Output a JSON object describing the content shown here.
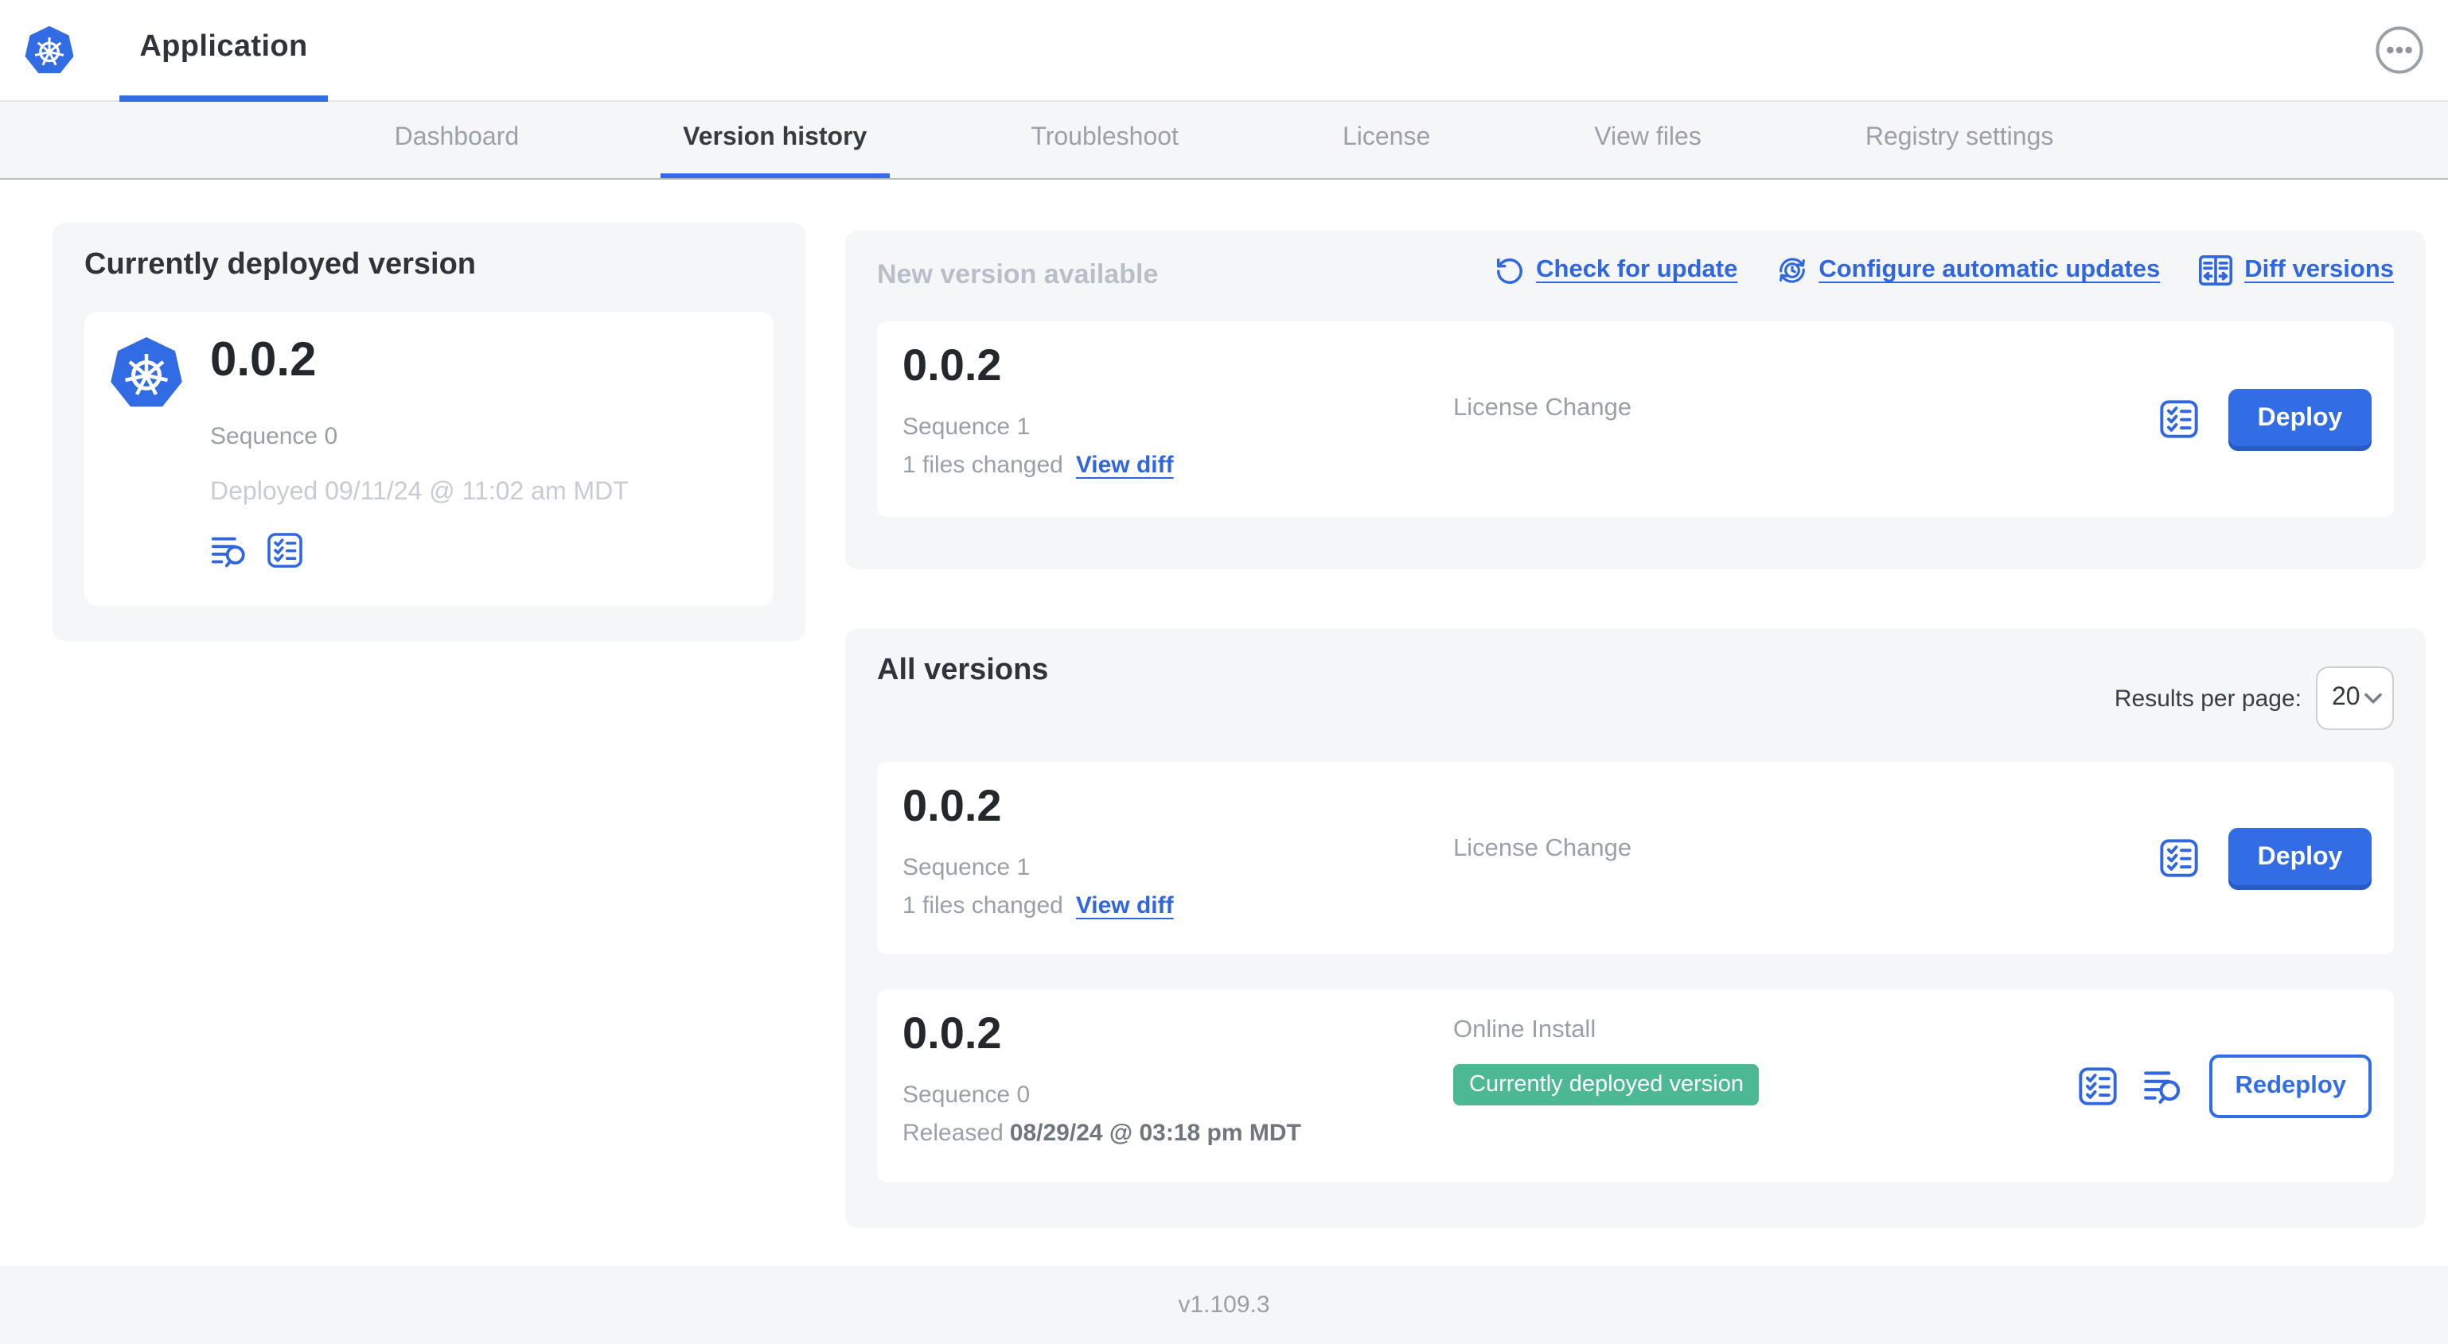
{
  "colors": {
    "accent": "#3066e0",
    "logo_blue": "#326ce5",
    "badge_green": "#4cb894",
    "button_blue": "#326de6"
  },
  "header": {
    "app_title": "Application",
    "menu_icon": "ellipsis-circle-icon",
    "logo_icon": "kubernetes-logo"
  },
  "nav": {
    "active_tab": "Version history",
    "tabs": [
      {
        "label": "Dashboard"
      },
      {
        "label": "Version history"
      },
      {
        "label": "Troubleshoot"
      },
      {
        "label": "License"
      },
      {
        "label": "View files"
      },
      {
        "label": "Registry settings"
      }
    ]
  },
  "current_version": {
    "title": "Currently deployed version",
    "version": "0.0.2",
    "sequence": "Sequence 0",
    "deployed": "Deployed 09/11/24 @ 11:02 am MDT",
    "icons": [
      "view-release-notes-icon",
      "preflight-checks-icon"
    ]
  },
  "new_version": {
    "title": "New version available",
    "actions": {
      "check": "Check for update",
      "configure": "Configure automatic updates",
      "diff": "Diff versions"
    },
    "entry": {
      "version": "0.0.2",
      "sequence": "Sequence 1",
      "files_changed": "1 files changed",
      "view_diff": "View diff",
      "source": "License Change",
      "deploy": "Deploy"
    }
  },
  "all_versions": {
    "title": "All versions",
    "results_per_page_label": "Results per page:",
    "results_per_page": "20",
    "rows": [
      {
        "version": "0.0.2",
        "sequence": "Sequence 1",
        "files_changed": "1 files changed",
        "view_diff": "View diff",
        "source": "License Change",
        "action": "Deploy"
      },
      {
        "version": "0.0.2",
        "sequence": "Sequence 0",
        "released_prefix": "Released",
        "released_date": "08/29/24 @ 03:18 pm MDT",
        "source": "Online Install",
        "badge": "Currently deployed version",
        "action": "Redeploy"
      }
    ]
  },
  "footer": {
    "app_version": "v1.109.3"
  }
}
